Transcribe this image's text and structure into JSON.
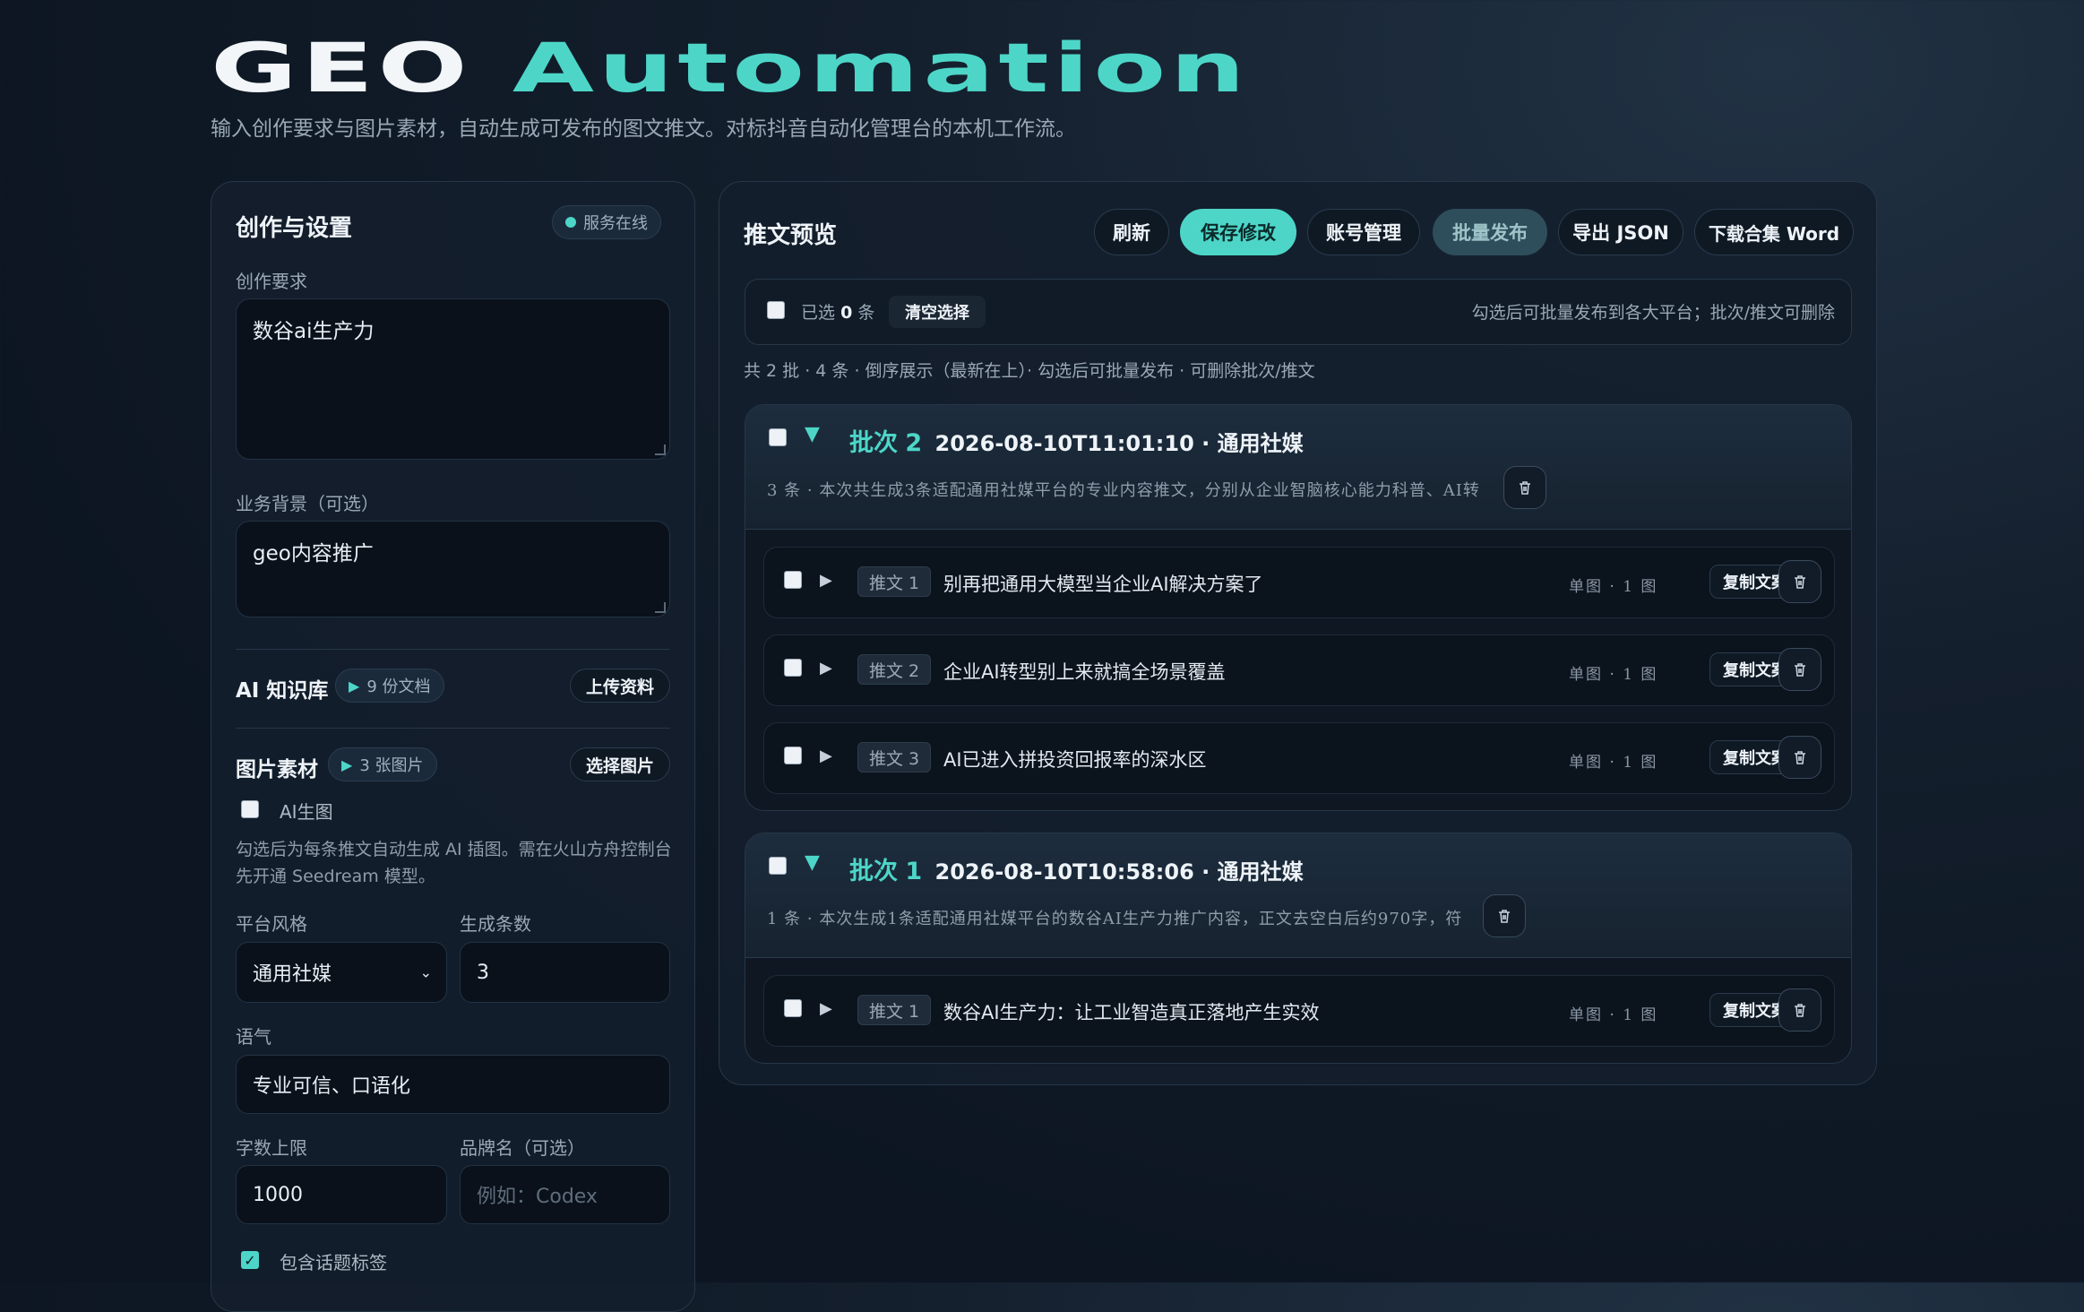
{
  "header": {
    "title_part1": "GEO",
    "title_part2": "Automation",
    "subtitle": "输入创作要求与图片素材，自动生成可发布的图文推文。对标抖音自动化管理台的本机工作流。"
  },
  "left": {
    "title": "创作与设置",
    "status": "服务在线",
    "req_label": "创作要求",
    "req_value": "数谷ai生产力",
    "bg_label": "业务背景（可选）",
    "bg_value": "geo内容推广",
    "kb_title": "AI 知识库",
    "kb_count": "9 份文档",
    "kb_upload": "上传资料",
    "img_title": "图片素材",
    "img_count": "3 张图片",
    "img_select": "选择图片",
    "ai_img_label": "AI生图",
    "ai_img_hint": "勾选后为每条推文自动生成 AI 插图。需在火山方舟控制台先开通 Seedream 模型。",
    "style_label": "平台风格",
    "style_value": "通用社媒",
    "count_label": "生成条数",
    "count_value": "3",
    "tone_label": "语气",
    "tone_value": "专业可信、口语化",
    "limit_label": "字数上限",
    "limit_value": "1000",
    "brand_label": "品牌名（可选）",
    "brand_placeholder": "例如：Codex",
    "hashtag_label": "包含话题标签"
  },
  "right": {
    "title": "推文预览",
    "buttons": {
      "refresh": "刷新",
      "save": "保存修改",
      "accounts": "账号管理",
      "batch_publish": "批量发布",
      "export_json": "导出 JSON",
      "download_word": "下载合集 Word"
    },
    "selbar": {
      "selected_prefix": "已选",
      "selected_count": "0",
      "selected_suffix": "条",
      "clear": "清空选择",
      "hint": "勾选后可批量发布到各大平台；批次/推文可删除"
    },
    "summary": "共 2 批 · 4 条 · 倒序展示（最新在上）· 勾选后可批量发布 · 可删除批次/推文",
    "batches": [
      {
        "label": "批次",
        "num": "2",
        "info": "2026-08-10T11:01:10 · 通用社媒",
        "desc": "3 条 · 本次共生成3条适配通用社媒平台的专业内容推文，分别从企业智脑核心能力科普、AI转",
        "items": [
          {
            "tag": "推文 1",
            "text": "别再把通用大模型当企业AI解决方案了",
            "meta": "单图 · 1 图",
            "copy": "复制文案"
          },
          {
            "tag": "推文 2",
            "text": "企业AI转型别上来就搞全场景覆盖",
            "meta": "单图 · 1 图",
            "copy": "复制文案"
          },
          {
            "tag": "推文 3",
            "text": "AI已进入拼投资回报率的深水区",
            "meta": "单图 · 1 图",
            "copy": "复制文案"
          }
        ]
      },
      {
        "label": "批次",
        "num": "1",
        "info": "2026-08-10T10:58:06 · 通用社媒",
        "desc": "1 条 · 本次生成1条适配通用社媒平台的数谷AI生产力推广内容，正文去空白后约970字，符",
        "items": [
          {
            "tag": "推文 1",
            "text": "数谷AI生产力：让工业智造真正落地产生实效",
            "meta": "单图 · 1 图",
            "copy": "复制文案"
          }
        ]
      }
    ]
  }
}
